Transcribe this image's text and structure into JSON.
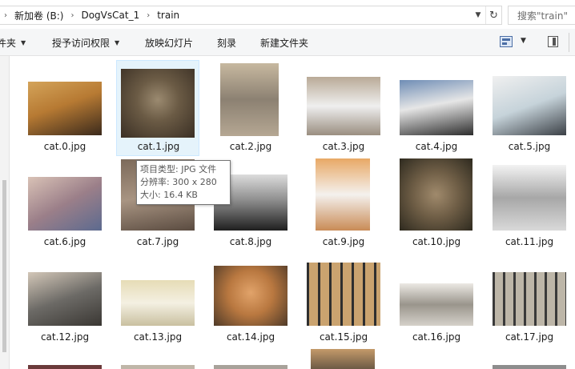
{
  "address": {
    "crumbs": [
      "新加卷 (B:)",
      "DogVsCat_1",
      "train"
    ],
    "search_placeholder": "搜索\"train\""
  },
  "toolbar": {
    "items": [
      "件夹",
      "授予访问权限",
      "放映幻灯片",
      "刻录",
      "新建文件夹"
    ]
  },
  "files": [
    {
      "name": "cat.0.jpg"
    },
    {
      "name": "cat.1.jpg"
    },
    {
      "name": "cat.2.jpg"
    },
    {
      "name": "cat.3.jpg"
    },
    {
      "name": "cat.4.jpg"
    },
    {
      "name": "cat.5.jpg"
    },
    {
      "name": "cat.6.jpg"
    },
    {
      "name": "cat.7.jpg"
    },
    {
      "name": "cat.8.jpg"
    },
    {
      "name": "cat.9.jpg"
    },
    {
      "name": "cat.10.jpg"
    },
    {
      "name": "cat.11.jpg"
    },
    {
      "name": "cat.12.jpg"
    },
    {
      "name": "cat.13.jpg"
    },
    {
      "name": "cat.14.jpg"
    },
    {
      "name": "cat.15.jpg"
    },
    {
      "name": "cat.16.jpg"
    },
    {
      "name": "cat.17.jpg"
    }
  ],
  "selected_file": "cat.1.jpg",
  "tooltip": {
    "type": "项目类型: JPG 文件",
    "resolution": "分辨率: 300 x 280",
    "size": "大小: 16.4 KB"
  },
  "colors": {
    "selection_bg": "#e5f3fb",
    "selection_border": "#cce8ff",
    "toolbar_bg": "#f5f6f7"
  }
}
